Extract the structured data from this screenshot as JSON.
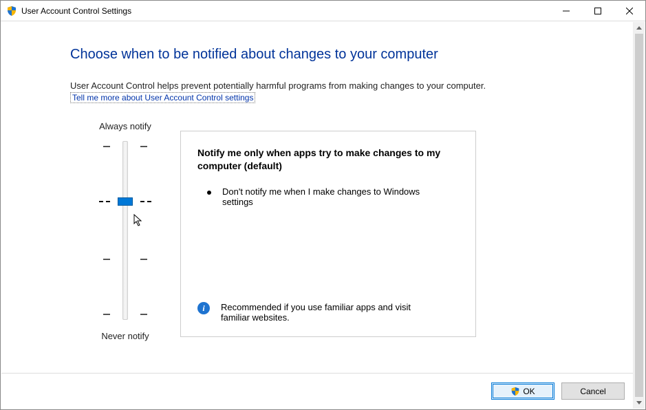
{
  "window": {
    "title": "User Account Control Settings",
    "icon": "shield-icon"
  },
  "heading": "Choose when to be notified about changes to your computer",
  "description": "User Account Control helps prevent potentially harmful programs from making changes to your computer.",
  "link_text": "Tell me more about User Account Control settings",
  "slider": {
    "top_label": "Always notify",
    "bottom_label": "Never notify",
    "levels": 4,
    "selected_index": 1
  },
  "notification_box": {
    "title": "Notify me only when apps try to make changes to my computer (default)",
    "bullet": "Don't notify me when I make changes to Windows settings",
    "recommendation": "Recommended if you use familiar apps and visit familiar websites."
  },
  "buttons": {
    "ok": "OK",
    "cancel": "Cancel"
  }
}
